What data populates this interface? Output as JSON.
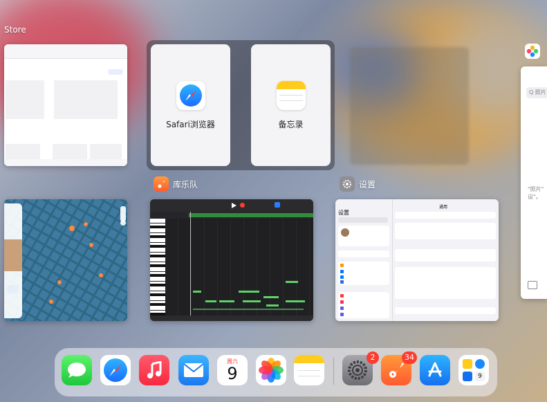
{
  "apps": {
    "app_store_label": "Store",
    "safari_label": "Safari浏览器",
    "notes_label": "备忘录",
    "garageband_label": "库乐队",
    "settings_label": "设置",
    "settings_header": "设置",
    "settings_detail_header": "通用",
    "photos_search": "Q 照片",
    "photos_snip": "\"照片\"\n设\"。"
  },
  "dock": {
    "calendar_weekday": "周六",
    "calendar_day": "9",
    "settings_badge": "2",
    "garageband_badge": "34"
  },
  "colors": {
    "badge": "#ff3b30",
    "piano_roll_notes": "#5ed36a",
    "maps_water": "#2c5f7a"
  }
}
